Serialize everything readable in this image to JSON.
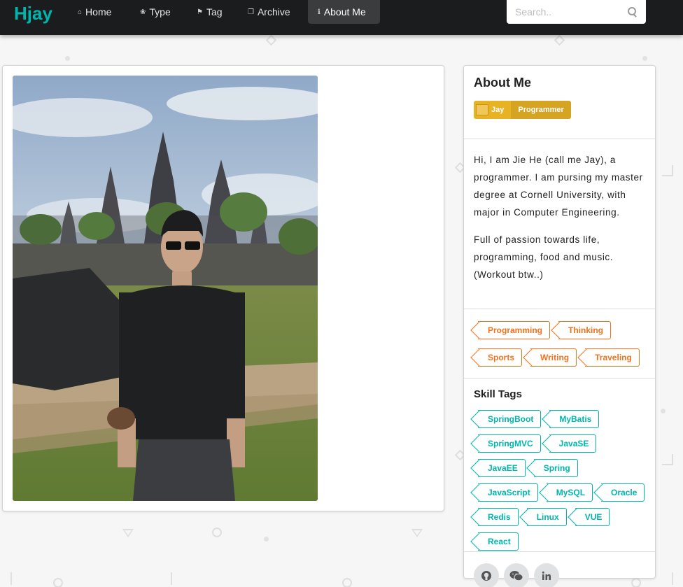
{
  "nav": {
    "brand": "Hjay",
    "items": [
      {
        "label": "Home",
        "icon": "home-icon",
        "glyph": "⌂"
      },
      {
        "label": "Type",
        "icon": "idea-icon",
        "glyph": "❀"
      },
      {
        "label": "Tag",
        "icon": "tags-icon",
        "glyph": "⚑"
      },
      {
        "label": "Archive",
        "icon": "clone-icon",
        "glyph": "❐"
      },
      {
        "label": "About Me",
        "icon": "info-icon",
        "glyph": "ℹ"
      }
    ],
    "active": "About Me",
    "search_placeholder": "Search.."
  },
  "about": {
    "title": "About Me",
    "name": "Jay",
    "role": "Programmer",
    "bio": [
      "Hi, I am Jie He (call me Jay), a programmer. I am pursing my master degree at Cornell University, with major in Computer Engineering.",
      "Full of passion towards life, programming, food and music. (Workout btw..)"
    ],
    "interests": [
      "Programming",
      "Thinking",
      "Sports",
      "Writing",
      "Traveling"
    ],
    "skills_title": "Skill Tags",
    "skills": [
      "SpringBoot",
      "MyBatis",
      "SpringMVC",
      "JavaSE",
      "JavaEE",
      "Spring",
      "JavaScript",
      "MySQL",
      "Oracle",
      "Redis",
      "Linux",
      "VUE",
      "React"
    ],
    "socials": [
      "github-icon",
      "wechat-icon",
      "linkedin-icon"
    ]
  },
  "colors": {
    "brand": "#00b5ad",
    "nav_bg": "#1b1c1d",
    "role_label": "#e8b225",
    "interest_tag": "#f2711c",
    "skill_tag": "#00b5ad"
  }
}
